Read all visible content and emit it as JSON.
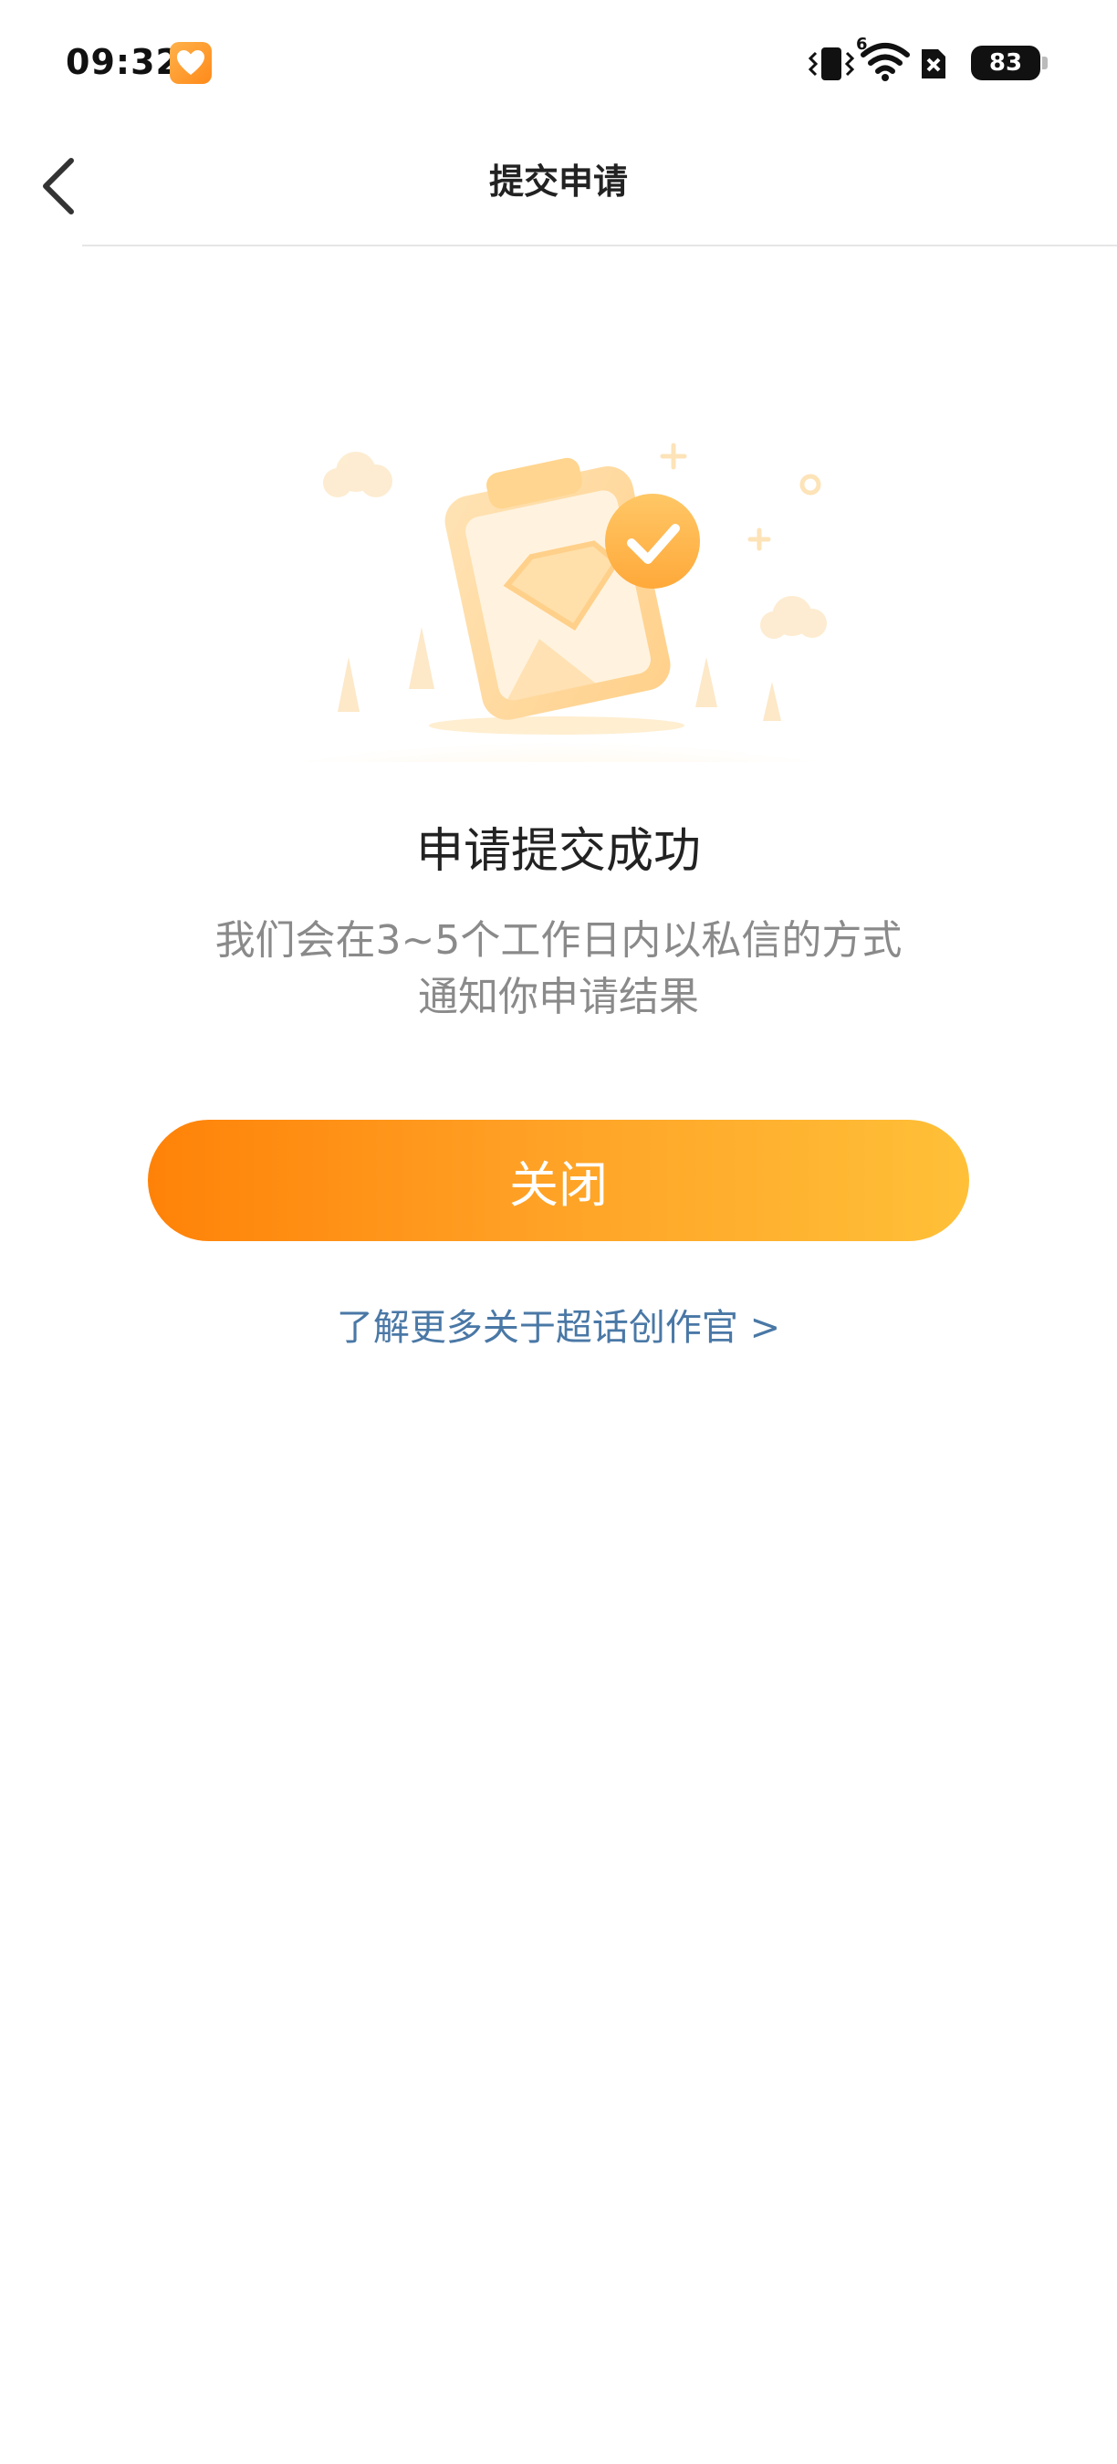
{
  "status_bar": {
    "time": "09:32",
    "network_type": "6",
    "battery_level": "83",
    "icons": [
      "app-heart-icon",
      "vibrate-icon",
      "wifi-icon",
      "sim-icon",
      "battery-icon"
    ]
  },
  "nav": {
    "title": "提交申请",
    "back_icon": "chevron-left-icon"
  },
  "illustration": {
    "icon": "clipboard-check-icon",
    "accent_color": "#ffb54a"
  },
  "result": {
    "title": "申请提交成功",
    "description_line1": "我们会在3~5个工作日内以私信的方式",
    "description_line2": "通知你申请结果"
  },
  "actions": {
    "close_label": "关闭",
    "learn_more_label": "了解更多关于超话创作官 >"
  },
  "colors": {
    "button_gradient_start": "#ff8208",
    "button_gradient_end": "#ffc038",
    "link": "#4a78a6"
  }
}
